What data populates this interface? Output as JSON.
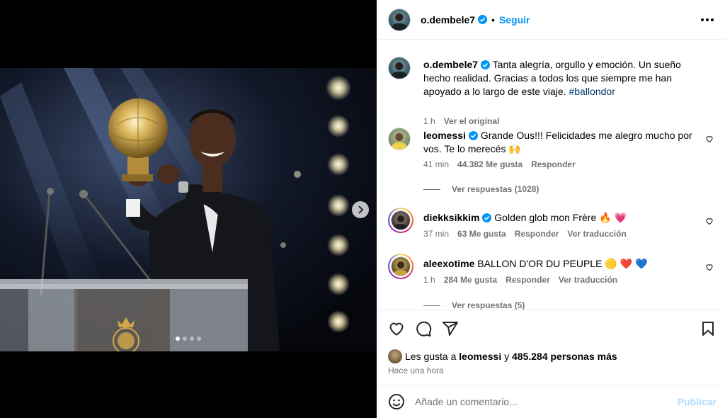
{
  "post": {
    "carousel": {
      "slide_count": 4,
      "active_index": 0
    },
    "author": {
      "username": "o.dembele7",
      "verified": true,
      "follow_label": "Seguir"
    },
    "caption": {
      "username": "o.dembele7",
      "text": "Tanta alegría, orgullo y emoción. Un sueño hecho realidad. Gracias a todos los que siempre me han apoyado a lo largo de este viaje.",
      "hashtag": "#ballondor",
      "time": "1 h",
      "see_original": "Ver el original"
    },
    "comments": [
      {
        "username": "leomessi",
        "text": "Grande Ous!!! Felicidades me alegro mucho por vos. Te lo merecés 🙌",
        "time": "41 min",
        "likes": "44.382 Me gusta",
        "reply": "Responder",
        "view_replies": "Ver respuestas (1028)"
      },
      {
        "username": "diekksikkim",
        "text": "Golden glob mon Frère 🔥 💗",
        "time": "37 min",
        "likes": "63 Me gusta",
        "reply": "Responder",
        "translate": "Ver traducción"
      },
      {
        "username": "aleexotime",
        "text": "BALLON D'OR DU PEUPLE 🟡 ❤️ 💙",
        "time": "1 h",
        "likes": "284 Me gusta",
        "reply": "Responder",
        "translate": "Ver traducción",
        "view_replies": "Ver respuestas (5)"
      }
    ],
    "likes_summary": {
      "prefix": "Les gusta a",
      "user": "leomessi",
      "joiner": "y",
      "others": "485.284 personas más"
    },
    "posted_ago": "Hace una hora",
    "add_comment": {
      "placeholder": "Añade un comentario...",
      "publish": "Publicar"
    }
  },
  "icons": [
    "verified-icon",
    "more-icon",
    "heart-icon",
    "comment-icon",
    "share-icon",
    "bookmark-icon",
    "emoji-icon",
    "chevron-right-icon"
  ],
  "colors": {
    "accent": "#0095f6",
    "verified": "#0095f6",
    "muted": "#737373",
    "publish_disabled": "#b3dbff"
  }
}
